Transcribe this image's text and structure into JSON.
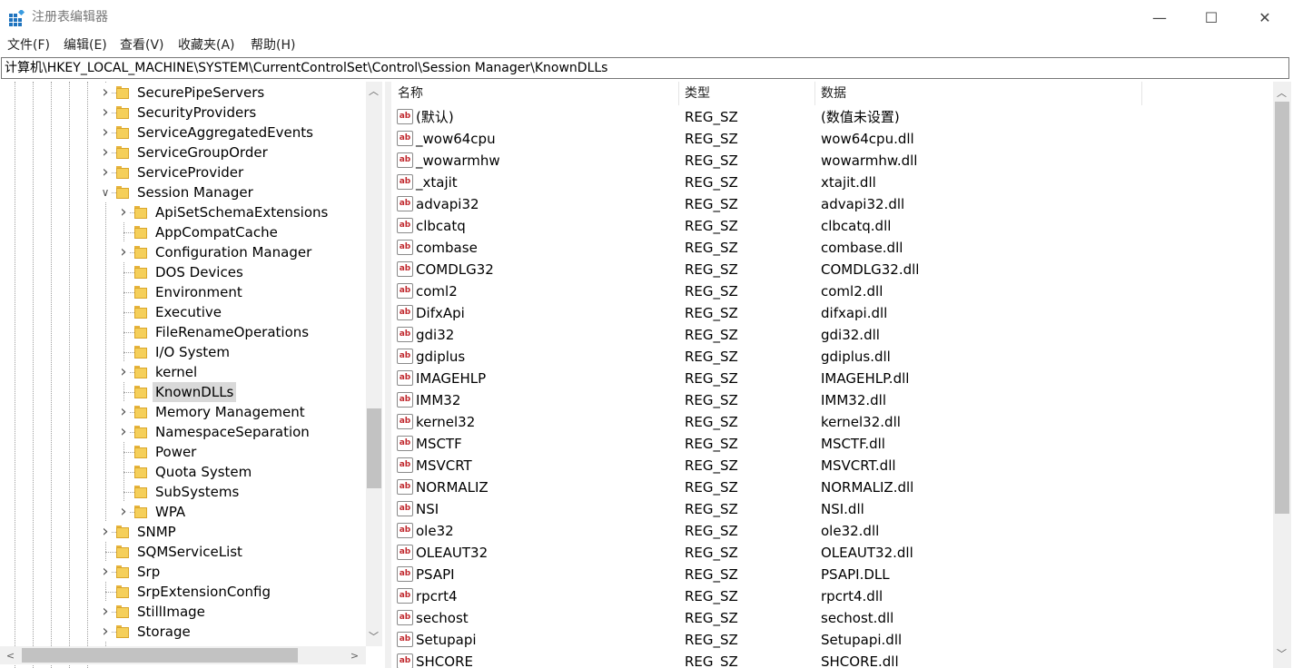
{
  "window": {
    "title": "注册表编辑器",
    "controls": {
      "minimize": "—",
      "maximize": "☐",
      "close": "✕"
    }
  },
  "menu": [
    "文件(F)",
    "编辑(E)",
    "查看(V)",
    "收藏夹(A)",
    "帮助(H)"
  ],
  "address": "计算机\\HKEY_LOCAL_MACHINE\\SYSTEM\\CurrentControlSet\\Control\\Session Manager\\KnownDLLs",
  "tree": [
    {
      "label": "SecurePipeServers",
      "expander": "collapsed",
      "level": 0
    },
    {
      "label": "SecurityProviders",
      "expander": "collapsed",
      "level": 0
    },
    {
      "label": "ServiceAggregatedEvents",
      "expander": "collapsed",
      "level": 0
    },
    {
      "label": "ServiceGroupOrder",
      "expander": "collapsed",
      "level": 0
    },
    {
      "label": "ServiceProvider",
      "expander": "collapsed",
      "level": 0
    },
    {
      "label": "Session Manager",
      "expander": "expanded",
      "level": 0
    },
    {
      "label": "ApiSetSchemaExtensions",
      "expander": "collapsed",
      "level": 1
    },
    {
      "label": "AppCompatCache",
      "expander": "none",
      "level": 1
    },
    {
      "label": "Configuration Manager",
      "expander": "collapsed",
      "level": 1
    },
    {
      "label": "DOS Devices",
      "expander": "none",
      "level": 1
    },
    {
      "label": "Environment",
      "expander": "none",
      "level": 1
    },
    {
      "label": "Executive",
      "expander": "none",
      "level": 1
    },
    {
      "label": "FileRenameOperations",
      "expander": "none",
      "level": 1
    },
    {
      "label": "I/O System",
      "expander": "none",
      "level": 1
    },
    {
      "label": "kernel",
      "expander": "collapsed",
      "level": 1
    },
    {
      "label": "KnownDLLs",
      "expander": "none",
      "level": 1,
      "selected": true
    },
    {
      "label": "Memory Management",
      "expander": "collapsed",
      "level": 1
    },
    {
      "label": "NamespaceSeparation",
      "expander": "collapsed",
      "level": 1
    },
    {
      "label": "Power",
      "expander": "none",
      "level": 1
    },
    {
      "label": "Quota System",
      "expander": "none",
      "level": 1
    },
    {
      "label": "SubSystems",
      "expander": "none",
      "level": 1
    },
    {
      "label": "WPA",
      "expander": "collapsed",
      "level": 1
    },
    {
      "label": "SNMP",
      "expander": "collapsed",
      "level": 0
    },
    {
      "label": "SQMServiceList",
      "expander": "none",
      "level": 0
    },
    {
      "label": "Srp",
      "expander": "collapsed",
      "level": 0
    },
    {
      "label": "SrpExtensionConfig",
      "expander": "none",
      "level": 0
    },
    {
      "label": "StillImage",
      "expander": "collapsed",
      "level": 0
    },
    {
      "label": "Storage",
      "expander": "collapsed",
      "level": 0
    }
  ],
  "list": {
    "columns": {
      "name": "名称",
      "type": "类型",
      "data": "数据"
    },
    "icon_text": "ab",
    "rows": [
      {
        "name": "(默认)",
        "type": "REG_SZ",
        "data": "(数值未设置)"
      },
      {
        "name": "_wow64cpu",
        "type": "REG_SZ",
        "data": "wow64cpu.dll"
      },
      {
        "name": "_wowarmhw",
        "type": "REG_SZ",
        "data": "wowarmhw.dll"
      },
      {
        "name": "_xtajit",
        "type": "REG_SZ",
        "data": "xtajit.dll"
      },
      {
        "name": "advapi32",
        "type": "REG_SZ",
        "data": "advapi32.dll"
      },
      {
        "name": "clbcatq",
        "type": "REG_SZ",
        "data": "clbcatq.dll"
      },
      {
        "name": "combase",
        "type": "REG_SZ",
        "data": "combase.dll"
      },
      {
        "name": "COMDLG32",
        "type": "REG_SZ",
        "data": "COMDLG32.dll"
      },
      {
        "name": "coml2",
        "type": "REG_SZ",
        "data": "coml2.dll"
      },
      {
        "name": "DifxApi",
        "type": "REG_SZ",
        "data": "difxapi.dll"
      },
      {
        "name": "gdi32",
        "type": "REG_SZ",
        "data": "gdi32.dll"
      },
      {
        "name": "gdiplus",
        "type": "REG_SZ",
        "data": "gdiplus.dll"
      },
      {
        "name": "IMAGEHLP",
        "type": "REG_SZ",
        "data": "IMAGEHLP.dll"
      },
      {
        "name": "IMM32",
        "type": "REG_SZ",
        "data": "IMM32.dll"
      },
      {
        "name": "kernel32",
        "type": "REG_SZ",
        "data": "kernel32.dll"
      },
      {
        "name": "MSCTF",
        "type": "REG_SZ",
        "data": "MSCTF.dll"
      },
      {
        "name": "MSVCRT",
        "type": "REG_SZ",
        "data": "MSVCRT.dll"
      },
      {
        "name": "NORMALIZ",
        "type": "REG_SZ",
        "data": "NORMALIZ.dll"
      },
      {
        "name": "NSI",
        "type": "REG_SZ",
        "data": "NSI.dll"
      },
      {
        "name": "ole32",
        "type": "REG_SZ",
        "data": "ole32.dll"
      },
      {
        "name": "OLEAUT32",
        "type": "REG_SZ",
        "data": "OLEAUT32.dll"
      },
      {
        "name": "PSAPI",
        "type": "REG_SZ",
        "data": "PSAPI.DLL"
      },
      {
        "name": "rpcrt4",
        "type": "REG_SZ",
        "data": "rpcrt4.dll"
      },
      {
        "name": "sechost",
        "type": "REG_SZ",
        "data": "sechost.dll"
      },
      {
        "name": "Setupapi",
        "type": "REG_SZ",
        "data": "Setupapi.dll"
      },
      {
        "name": "SHCORE",
        "type": "REG_SZ",
        "data": "SHCORE.dll"
      }
    ]
  },
  "scrollbars": {
    "up": "︿",
    "down": "﹀",
    "left": "<",
    "right": ">"
  },
  "colors": {
    "selection": "#d9d9d9",
    "folder": "#f5cf5a",
    "string_icon_text": "#c0282d"
  }
}
